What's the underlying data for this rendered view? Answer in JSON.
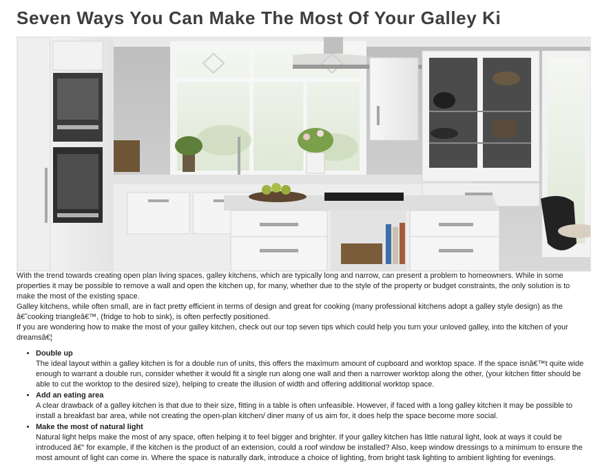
{
  "article": {
    "title": "Seven Ways You Can Make The Most Of Your Galley Ki",
    "image_alt": "Bright white galley style kitchen with island, hob and glass display cabinets",
    "intro": [
      "With the trend towards creating open plan living spaces, galley kitchens, which are typically long and narrow, can present a problem to homeowners. While in some properties it may be possible to remove a wall and open the kitchen up, for many, whether due to the style of the property or budget constraints, the only solution is to make the most of the existing space.",
      "Galley kitchens, while often small, are in fact pretty efficient in terms of design and great for cooking (many professional kitchens adopt a galley style design) as the â€˜cooking triangleâ€™, (fridge to hob to sink), is often perfectly positioned.",
      "If you are wondering how to make the most of your galley kitchen, check out our top seven tips which could help you turn your unloved galley, into the kitchen of your dreamsâ€¦"
    ],
    "tips": [
      {
        "heading": "Double up",
        "body": "The ideal layout within a galley kitchen is for a double run of units, this offers the maximum amount of cupboard and worktop space. If the space isnâ€™t quite wide enough to warrant a double run, consider whether it would fit a single run along one wall and then a narrower worktop along the other, (your kitchen fitter should be able to cut the worktop to the desired size), helping to create the illusion of width and offering additional worktop space."
      },
      {
        "heading": "Add an eating area",
        "body": "A clear drawback of a galley kitchen is that due to their size, fitting in a table is often unfeasible. However, if faced with a long galley kitchen it may be possible to install a breakfast bar area, while not creating the open-plan kitchen/ diner many of us aim for, it does help the space become more social."
      },
      {
        "heading": "Make the most of natural light",
        "body": "Natural light helps make the most of any space, often helping it to feel bigger and brighter. If your galley kitchen has little natural light, look at ways it could be introduced â€“ for example, if the kitchen is the product of an extension, could a roof window be installed? Also, keep window dressings to a minimum to ensure the most amount of light can come in. Where the space is naturally dark, introduce a choice of lighting, from bright task lighting to ambient lighting for evenings."
      }
    ]
  }
}
